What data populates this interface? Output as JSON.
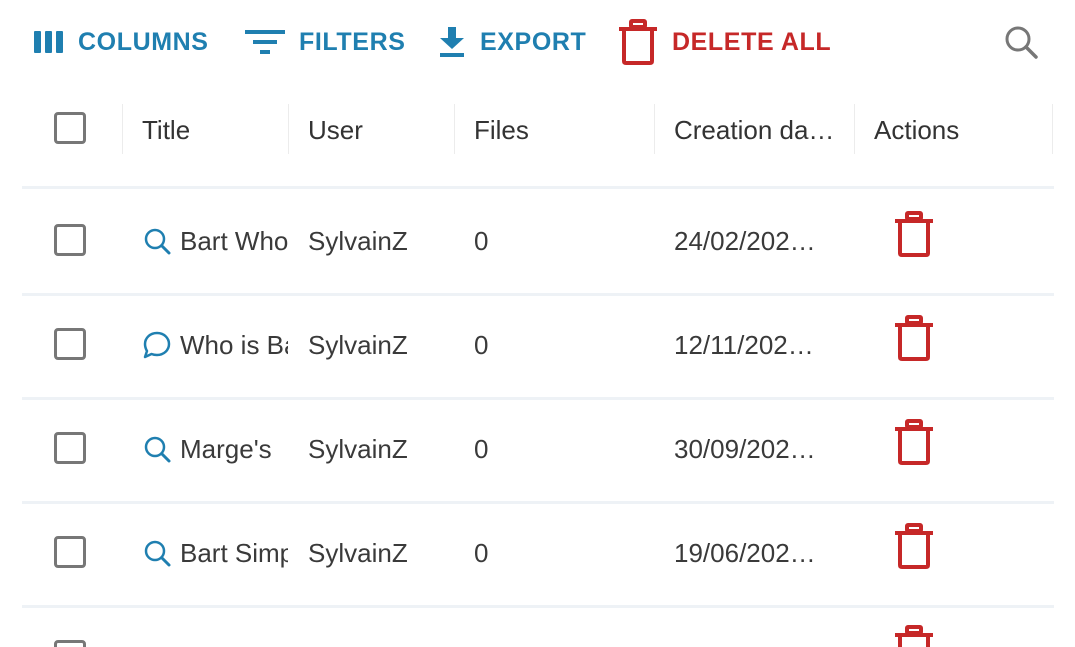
{
  "toolbar": {
    "columns_label": "COLUMNS",
    "filters_label": "FILTERS",
    "export_label": "EXPORT",
    "delete_all_label": "DELETE ALL"
  },
  "table": {
    "columns": [
      "Title",
      "User",
      "Files",
      "Creation da…",
      "Actions"
    ],
    "rows": [
      {
        "title": "Bart Who",
        "title_icon": "search-icon",
        "user": "SylvainZ",
        "files": "0",
        "date": "24/02/202…"
      },
      {
        "title": "Who is Bart",
        "title_icon": "chat-bubble-icon",
        "user": "SylvainZ",
        "files": "0",
        "date": "12/11/202…"
      },
      {
        "title": "Marge's",
        "title_icon": "search-icon",
        "user": "SylvainZ",
        "files": "0",
        "date": "30/09/202…"
      },
      {
        "title": "Bart Simpson",
        "title_icon": "search-icon",
        "user": "SylvainZ",
        "files": "0",
        "date": "19/06/202…"
      }
    ]
  },
  "colors": {
    "accent_blue": "#1f7fb0",
    "danger_red": "#c62828"
  }
}
